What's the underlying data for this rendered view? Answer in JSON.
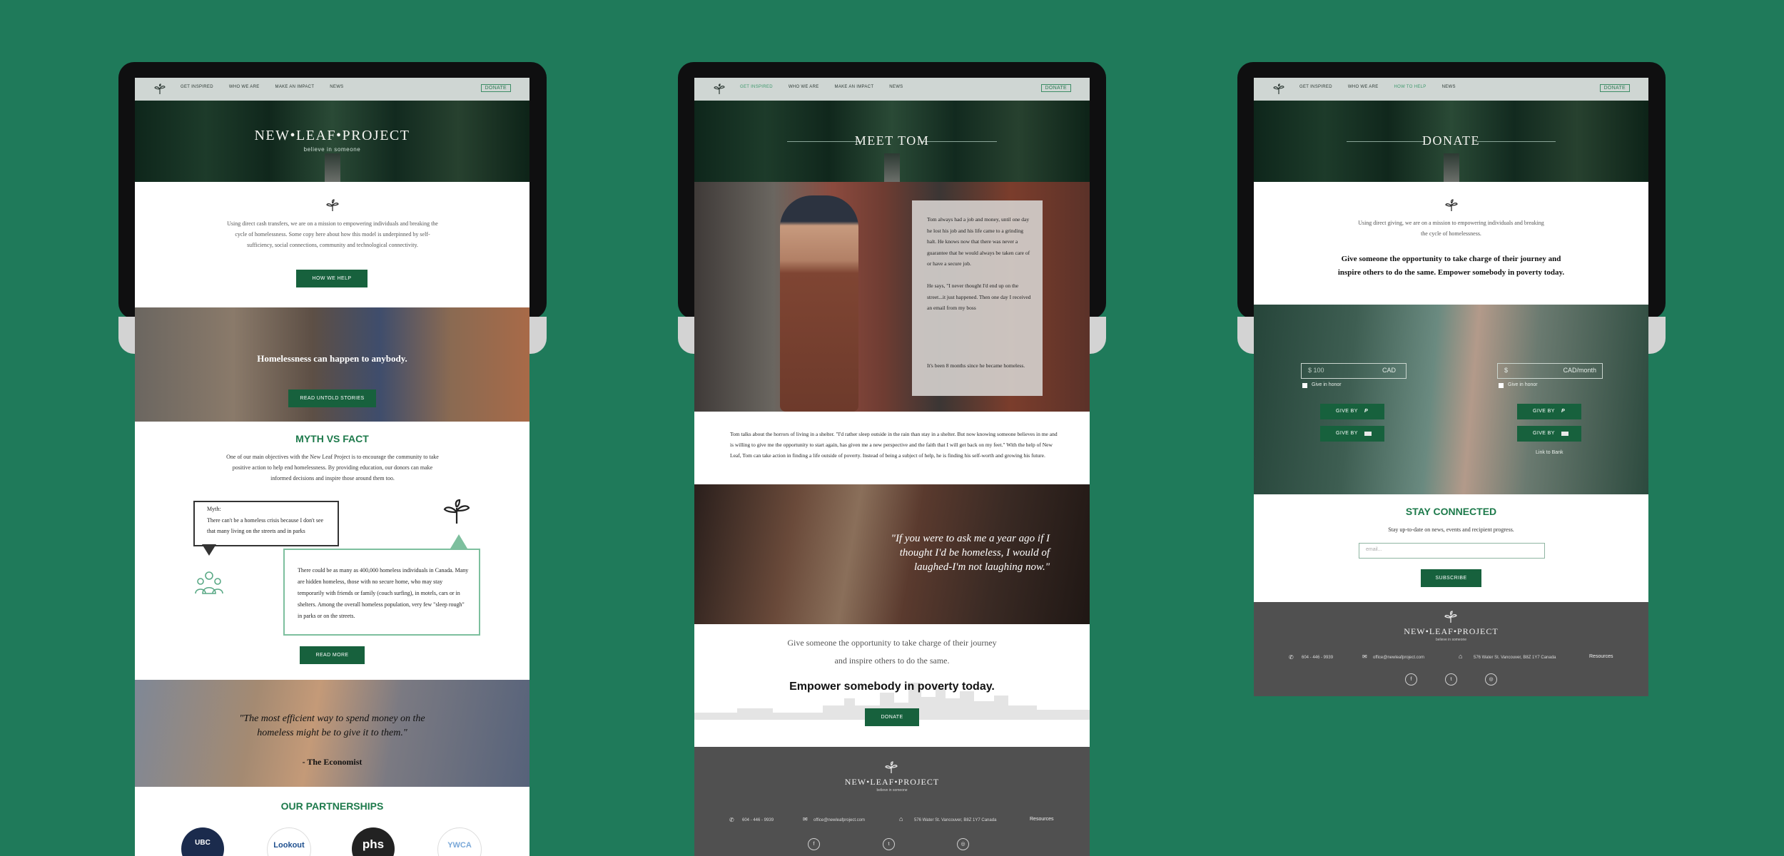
{
  "nav": {
    "items": [
      "GET INSPIRED",
      "WHO WE ARE",
      "MAKE AN IMPACT",
      "NEWS"
    ],
    "items_donate": [
      "GET INSPIRED",
      "WHO WE ARE",
      "HOW TO HELP",
      "NEWS"
    ],
    "donate": "DONATE"
  },
  "home": {
    "brand": "NEW•LEAF•PROJECT",
    "tagline": "believe in someone",
    "intro": "Using direct cash transfers, we are on a mission to empowering individuals and breaking the cycle of homelessness. Some copy here about how this model is underpinned by self-sufficiency, social connections, community and technological connectivity.",
    "how_we_help": "HOW WE HELP",
    "banner_title": "Homelessness can happen to anybody.",
    "read_stories": "READ UNTOLD STORIES",
    "myth_title": "MYTH VS FACT",
    "myth_intro": "One of our main objectives with the New Leaf Project is to encourage the community to take positive action to help end homelessness. By providing education, our donors can make informed decisions and inspire those around them too.",
    "myth_label": "Myth:",
    "myth_text": "There can't be a homeless crisis because I don't see that many living on the streets and in parks",
    "fact_text": "There could be as many as 400,000 homeless individuals in Canada. Many are hidden homeless, those with no secure home, who may stay temporarily with friends or family (couch surfing), in motels, cars or in shelters. Among the overall homeless population, very few \"sleep rough\" in parks or on the streets.",
    "read_more": "READ MORE",
    "quote": "\"The most efficient way to spend money on the homeless might be to give it to them.\"",
    "quote_source": "- The Economist",
    "partners_title": "OUR PARTNERSHIPS",
    "partners": [
      "UBC",
      "Lookout",
      "phs",
      "YWCA"
    ]
  },
  "story": {
    "title": "MEET TOM",
    "card_text_1": "Tom always had a job and money, until one day he lost his job and his life came to a grinding halt. He knows now that there was never a guarantee that he would always be taken care of or have a secure job.",
    "card_text_2": "He says, \"I never thought I'd end up on the street...it just happened. Then one day I received an email from my boss",
    "card_text_3": "It's been 8 months since he became homeless.",
    "body": "Tom talks about the horrors of living  in  a shelter. \"I'd rather sleep outside in the rain than stay in a shelter. But now knowing someone believes in me and is willing to give me the opportunity to start again, has given me a new perspective and the faith that I will get back on my feet.\" With the help of New Leaf, Tom can take action in finding a life outside of poverty. Instead of being a subject of help, he is finding his self-worth and growing his future.",
    "quote": "\"If you were to ask me a year ago if I thought I'd be homeless, I would of laughed-I'm not laughing now.\"",
    "cta_line_1": "Give someone the opportunity to take charge of their journey",
    "cta_line_2": "and inspire others to do the same.",
    "cta_bold": "Empower somebody in poverty today.",
    "donate": "DONATE"
  },
  "donate_page": {
    "title": "DONATE",
    "intro": "Using direct giving, we are on a mission to empowering individuals and breaking the cycle of homelessness.",
    "headline": "Give someone the opportunity to take charge of their journey and inspire others to do the same. Empower somebody in poverty today.",
    "amount_placeholder": "$ 100",
    "currency_once": "CAD",
    "amount_monthly": "$",
    "currency_monthly": "CAD/month",
    "honor": "Give in honor",
    "give_by": "GIVE BY",
    "link_bank": "Link to Bank",
    "stay_connected": "STAY CONNECTED",
    "stay_sub": "Stay up-to-date on news, events and recipient progress.",
    "email_placeholder": "email...",
    "subscribe": "SUBSCRIBE"
  },
  "footer": {
    "brand": "NEW•LEAF•PROJECT",
    "tagline": "believe in someone",
    "phone": "604 - 446 - 9939",
    "email": "office@newleafproject.com",
    "address": "576 Water St. Vancouver, B8Z 1Y7 Canada",
    "resources": "Resources"
  },
  "colors": {
    "background": "#1f7a5a",
    "brand_green": "#17613d",
    "footer": "#505050"
  }
}
